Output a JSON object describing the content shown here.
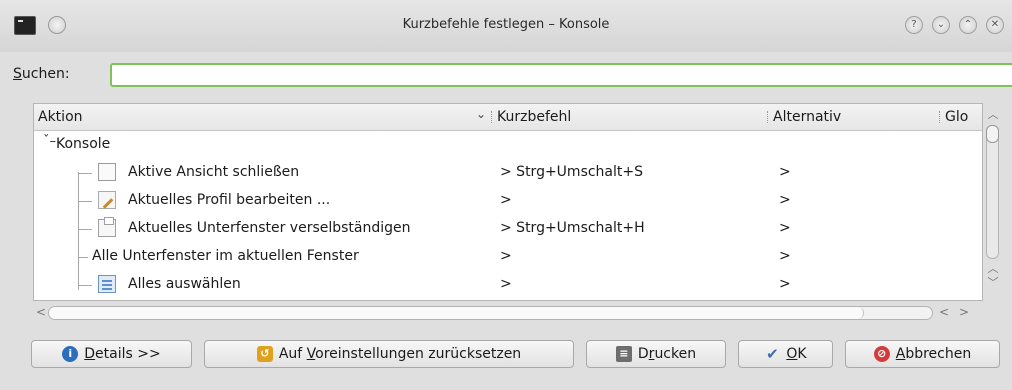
{
  "window": {
    "title": "Kurzbefehle festlegen – Konsole",
    "buttons": {
      "help": "?",
      "minimize": "⌄",
      "maximize": "⌃",
      "close": "✕"
    }
  },
  "search": {
    "label_first": "S",
    "label_rest": "uchen:",
    "value": "",
    "placeholder": ""
  },
  "tree": {
    "columns": {
      "action": "Aktion",
      "shortcut": "Kurzbefehl",
      "alternative": "Alternativ",
      "global": "Glo"
    },
    "group": {
      "label": "Konsole",
      "expanded": true
    },
    "rows": [
      {
        "label": "Aktive Ansicht schließen",
        "icon": "window-close-icon",
        "shortcut": "> Strg+Umschalt+S",
        "alternative": ">"
      },
      {
        "label": "Aktuelles Profil bearbeiten ...",
        "icon": "edit-profile-icon",
        "shortcut": ">",
        "alternative": ">"
      },
      {
        "label": "Aktuelles Unterfenster verselbständigen",
        "icon": "detach-tab-icon",
        "shortcut": "> Strg+Umschalt+H",
        "alternative": ">"
      },
      {
        "label": "Alle Unterfenster im aktuellen Fenster",
        "icon": "",
        "shortcut": ">",
        "alternative": ">"
      },
      {
        "label": "Alles auswählen",
        "icon": "select-all-icon",
        "shortcut": ">",
        "alternative": ">"
      }
    ]
  },
  "footer": {
    "details": {
      "u": "D",
      "rest": "etails >>",
      "icon": "info-icon",
      "color": "#2a6ebd"
    },
    "defaults": {
      "pre": "Auf ",
      "u": "V",
      "rest": "oreinstellungen zurücksetzen",
      "icon": "reset-icon",
      "color": "#e0a21e"
    },
    "print": {
      "pre": "D",
      "u": "r",
      "rest": "ucken",
      "icon": "printer-icon"
    },
    "ok": {
      "u": "O",
      "rest": "K",
      "icon": "checkmark-icon",
      "color": "#3b6fb5"
    },
    "cancel": {
      "u": "A",
      "rest": "bbrechen",
      "icon": "cancel-icon",
      "color": "#d63b3b"
    }
  }
}
